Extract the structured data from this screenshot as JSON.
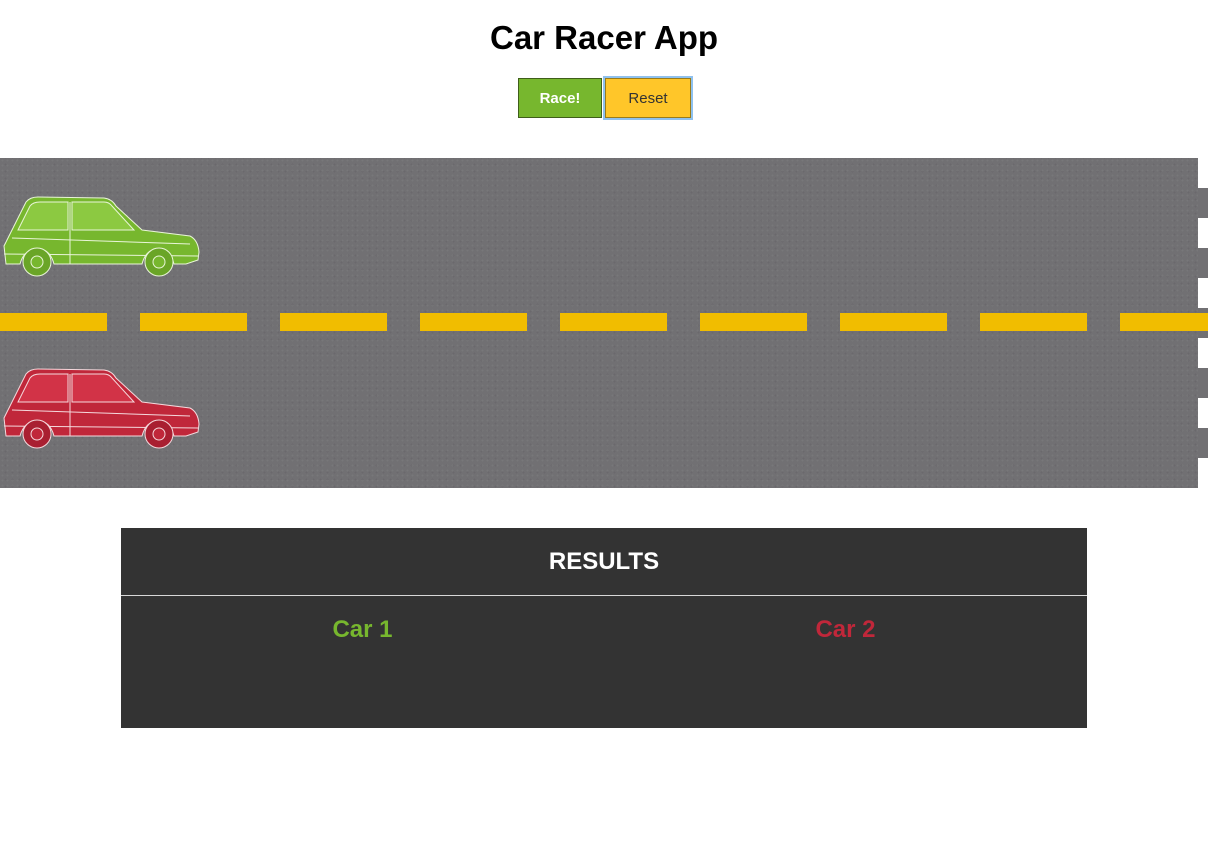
{
  "header": {
    "title": "Car Racer App"
  },
  "controls": {
    "race_label": "Race!",
    "reset_label": "Reset"
  },
  "track": {
    "lanes": [
      {
        "car": "car-1",
        "color": "#77b72e"
      },
      {
        "car": "car-2",
        "color": "#c0273a"
      }
    ],
    "asphalt_color": "#717073",
    "divider_color": "#f1bd00"
  },
  "results": {
    "title": "RESULTS",
    "car1_label": "Car 1",
    "car2_label": "Car 2",
    "car1_color": "#77b72e",
    "car2_color": "#c0273a"
  }
}
